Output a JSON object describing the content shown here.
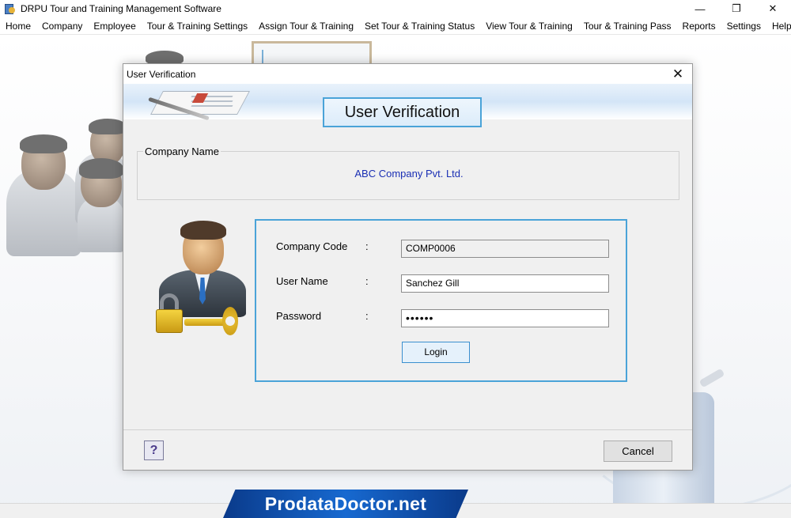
{
  "app": {
    "title": "DRPU Tour and Training Management Software",
    "icon": "app-icon",
    "controls": {
      "minimize": "—",
      "restore": "❐",
      "close": "✕"
    }
  },
  "menu": [
    "Home",
    "Company",
    "Employee",
    "Tour & Training Settings",
    "Assign Tour & Training",
    "Set Tour & Training Status",
    "View Tour & Training",
    "Tour & Training Pass",
    "Reports",
    "Settings",
    "Help"
  ],
  "dialog": {
    "title": "User Verification",
    "close_glyph": "✕",
    "banner_title": "User Verification",
    "company_group_label": "Company Name",
    "company_name": "ABC Company Pvt. Ltd.",
    "fields": {
      "company_code": {
        "label": "Company Code",
        "colon": ":",
        "value": "COMP0006"
      },
      "user_name": {
        "label": "User Name",
        "colon": ":",
        "value": "Sanchez Gill"
      },
      "password": {
        "label": "Password",
        "colon": ":",
        "value": "••••••"
      }
    },
    "login_label": "Login",
    "help_glyph": "?",
    "cancel_label": "Cancel"
  },
  "watermark": "ProdataDoctor.net",
  "colors": {
    "accent_border": "#4aa3d8",
    "company_name_text": "#1a2fb4",
    "watermark_bg": "#1769d0"
  }
}
